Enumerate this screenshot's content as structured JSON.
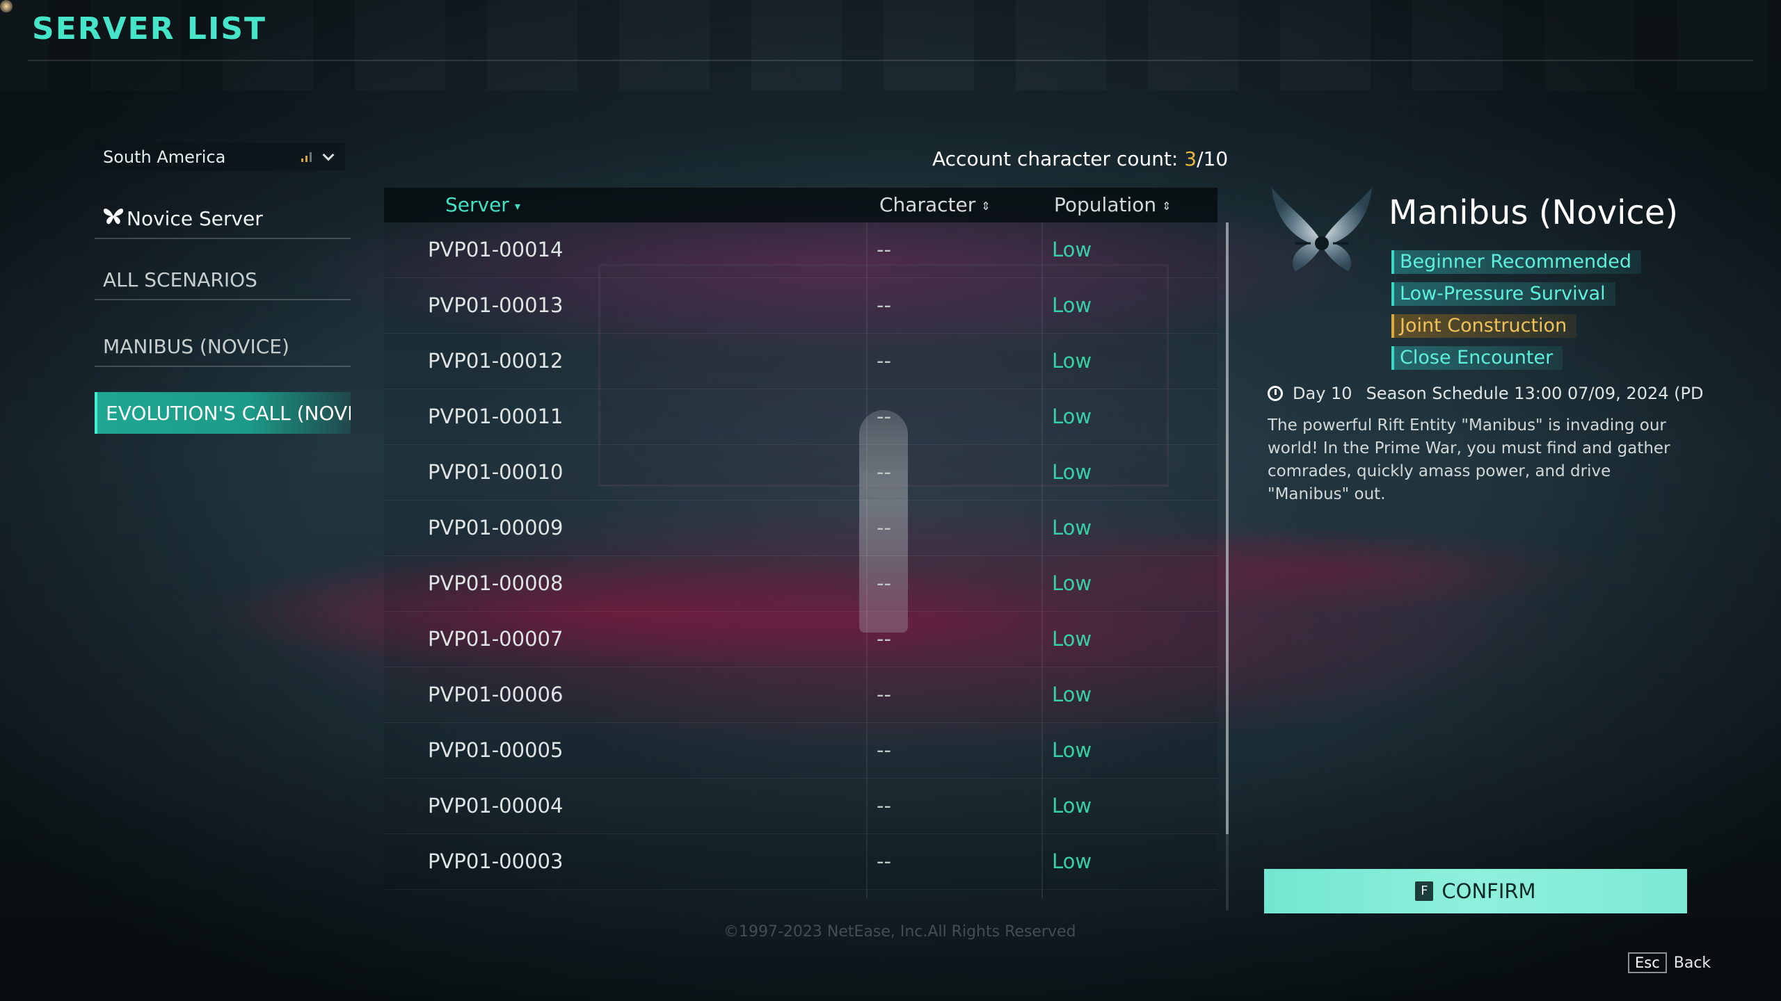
{
  "header": {
    "title": "SERVER LIST"
  },
  "sidebar": {
    "region": "South America",
    "items": [
      {
        "label": "Novice Server"
      },
      {
        "label": "ALL SCENARIOS"
      },
      {
        "label": "MANIBUS (NOVICE)"
      },
      {
        "label": "EVOLUTION'S CALL (NOVI"
      }
    ]
  },
  "account": {
    "label": "Account character count: ",
    "current": "3",
    "separator": "/",
    "max": "10"
  },
  "table": {
    "columns": {
      "server": "Server",
      "character": "Character",
      "population": "Population"
    },
    "rows": [
      {
        "name": "PVP01-00014",
        "character": "--",
        "population": "Low"
      },
      {
        "name": "PVP01-00013",
        "character": "--",
        "population": "Low"
      },
      {
        "name": "PVP01-00012",
        "character": "--",
        "population": "Low"
      },
      {
        "name": "PVP01-00011",
        "character": "--",
        "population": "Low"
      },
      {
        "name": "PVP01-00010",
        "character": "--",
        "population": "Low"
      },
      {
        "name": "PVP01-00009",
        "character": "--",
        "population": "Low"
      },
      {
        "name": "PVP01-00008",
        "character": "--",
        "population": "Low"
      },
      {
        "name": "PVP01-00007",
        "character": "--",
        "population": "Low"
      },
      {
        "name": "PVP01-00006",
        "character": "--",
        "population": "Low"
      },
      {
        "name": "PVP01-00005",
        "character": "--",
        "population": "Low"
      },
      {
        "name": "PVP01-00004",
        "character": "--",
        "population": "Low"
      },
      {
        "name": "PVP01-00003",
        "character": "--",
        "population": "Low"
      }
    ]
  },
  "detail": {
    "title": "Manibus (Novice)",
    "tags": [
      {
        "label": "Beginner Recommended",
        "color": "#5ef0dc"
      },
      {
        "label": "Low-Pressure Survival",
        "color": "#5ef0dc"
      },
      {
        "label": "Joint Construction",
        "color": "#efc25a"
      },
      {
        "label": "Close Encounter",
        "color": "#5ef0dc"
      }
    ],
    "day": "Day 10",
    "schedule": "Season Schedule 13:00 07/09, 2024 (PD",
    "description": "The powerful Rift Entity \"Manibus\" is invading our world! In the Prime War, you must find and gather comrades, quickly amass power, and drive \"Manibus\" out.",
    "confirm_key": "F",
    "confirm_label": "CONFIRM"
  },
  "footer": {
    "copyright": "©1997-2023 NetEase, Inc.All Rights Reserved",
    "back_key": "Esc",
    "back_label": "Back"
  },
  "colors": {
    "accent": "#46e4c8",
    "population_low": "#37d0a6",
    "highlight": "#e9b73e"
  }
}
